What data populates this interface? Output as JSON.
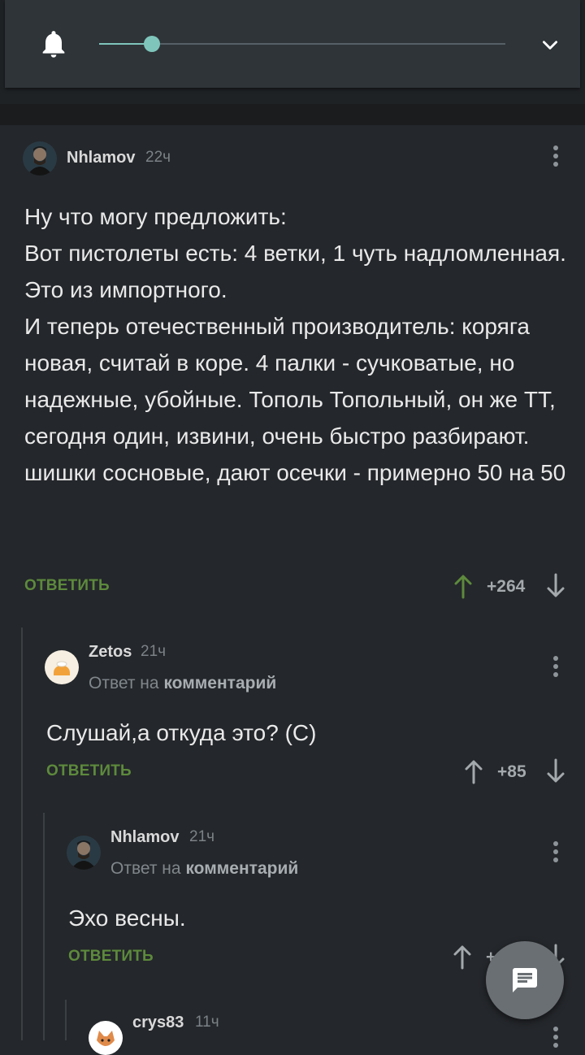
{
  "colors": {
    "accent": "#7fc5bb",
    "reply": "#5d8a3c",
    "upvote_active": "#5d8a3c",
    "background": "#24272b"
  },
  "topbar": {
    "icon": "bell-icon",
    "slider_level_percent": 13,
    "dropdown_icon": "chevron-down-icon"
  },
  "comments": [
    {
      "author": "Nhlamov",
      "time": "22ч",
      "reply_to": null,
      "text": "Ну что могу предложить:\nВот пистолеты есть: 4 ветки, 1 чуть надломленная. Это из импортного.\nИ теперь отечественный производитель: коряга новая, считай в коре. 4 палки - сучковатые, но надежные, убойные. Тополь Топольный, он же ТТ, сегодня один, извини, очень быстро разбирают.\nшишки сосновые, дают осечки - примерно 50 на 50",
      "reply_label": "ОТВЕТИТЬ",
      "score": "+264"
    },
    {
      "author": "Zetos",
      "time": "21ч",
      "reply_to_prefix": "Ответ на",
      "reply_to_target": "комментарий",
      "text": "Слушай,а откуда это? (С)",
      "reply_label": "ОТВЕТИТЬ",
      "score": "+85"
    },
    {
      "author": "Nhlamov",
      "time": "21ч",
      "reply_to_prefix": "Ответ на",
      "reply_to_target": "комментарий",
      "text": "Эхо весны.",
      "reply_label": "ОТВЕТИТЬ",
      "score": "+"
    },
    {
      "author": "crys83",
      "time": "11ч"
    }
  ],
  "fab": {
    "icon": "comment-icon"
  }
}
